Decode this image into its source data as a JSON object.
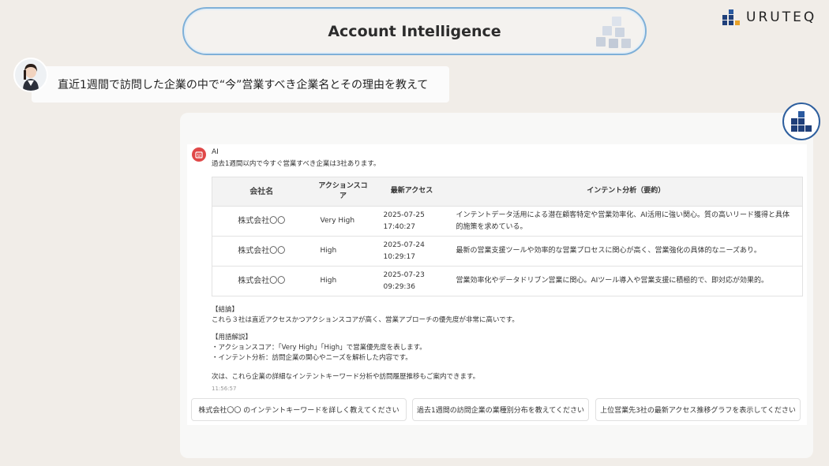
{
  "header": {
    "title": "Account Intelligence",
    "brand": "URUTEQ"
  },
  "user": {
    "question": "直近1週間で訪問した企業の中で“今”営業すべき企業名とその理由を教えて"
  },
  "answer": {
    "sender": "AI",
    "intro": "過去1週間以内で今すぐ営業すべき企業は3社あります。",
    "table": {
      "headers": [
        "会社名",
        "アクションスコア",
        "最新アクセス",
        "インテント分析（要約）"
      ],
      "rows": [
        {
          "company": "株式会社〇〇",
          "score": "Very High",
          "date": "2025-07-25",
          "time": "17:40:27",
          "intent": "インテントデータ活用による潜在顧客特定や営業効率化、AI活用に強い関心。質の高いリード獲得と具体的施策を求めている。"
        },
        {
          "company": "株式会社〇〇",
          "score": "High",
          "date": "2025-07-24",
          "time": "10:29:17",
          "intent": "最新の営業支援ツールや効率的な営業プロセスに関心が高く、営業強化の具体的なニーズあり。"
        },
        {
          "company": "株式会社〇〇",
          "score": "High",
          "date": "2025-07-23",
          "time": "09:29:36",
          "intent": "営業効率化やデータドリブン営業に関心。AIツール導入や営業支援に積極的で、即対応が効果的。"
        }
      ]
    },
    "conclusion_heading": "【結論】",
    "conclusion": "これら３社は直近アクセスかつアクションスコアが高く、営業アプローチの優先度が非常に高いです。",
    "glossary_heading": "【用語解説】",
    "glossary": [
      "・アクションスコア：「Very High」「High」で営業優先度を表します。",
      "・インテント分析：訪問企業の関心やニーズを解析した内容です。"
    ],
    "next": "次は、これら企業の詳細なインテントキーワード分析や訪問履歴推移もご案内できます。",
    "timestamp": "11:56:57"
  },
  "suggestions": [
    "株式会社〇〇 のインテントキーワードを詳しく教えてください",
    "過去1週間の訪問企業の業種別分布を教えてください",
    "上位営業先3社の最新アクセス推移グラフを表示してください"
  ],
  "colors": {
    "background": "#f1ede8",
    "accent_blue": "#2e5f9e",
    "ai_red": "#e04848",
    "pill_border": "#7fb0d8"
  },
  "icons": {
    "brand": "uruteq-logo-icon",
    "title": "cubes-icon",
    "bot": "bot-logo-icon",
    "ai": "ai-robot-icon"
  }
}
